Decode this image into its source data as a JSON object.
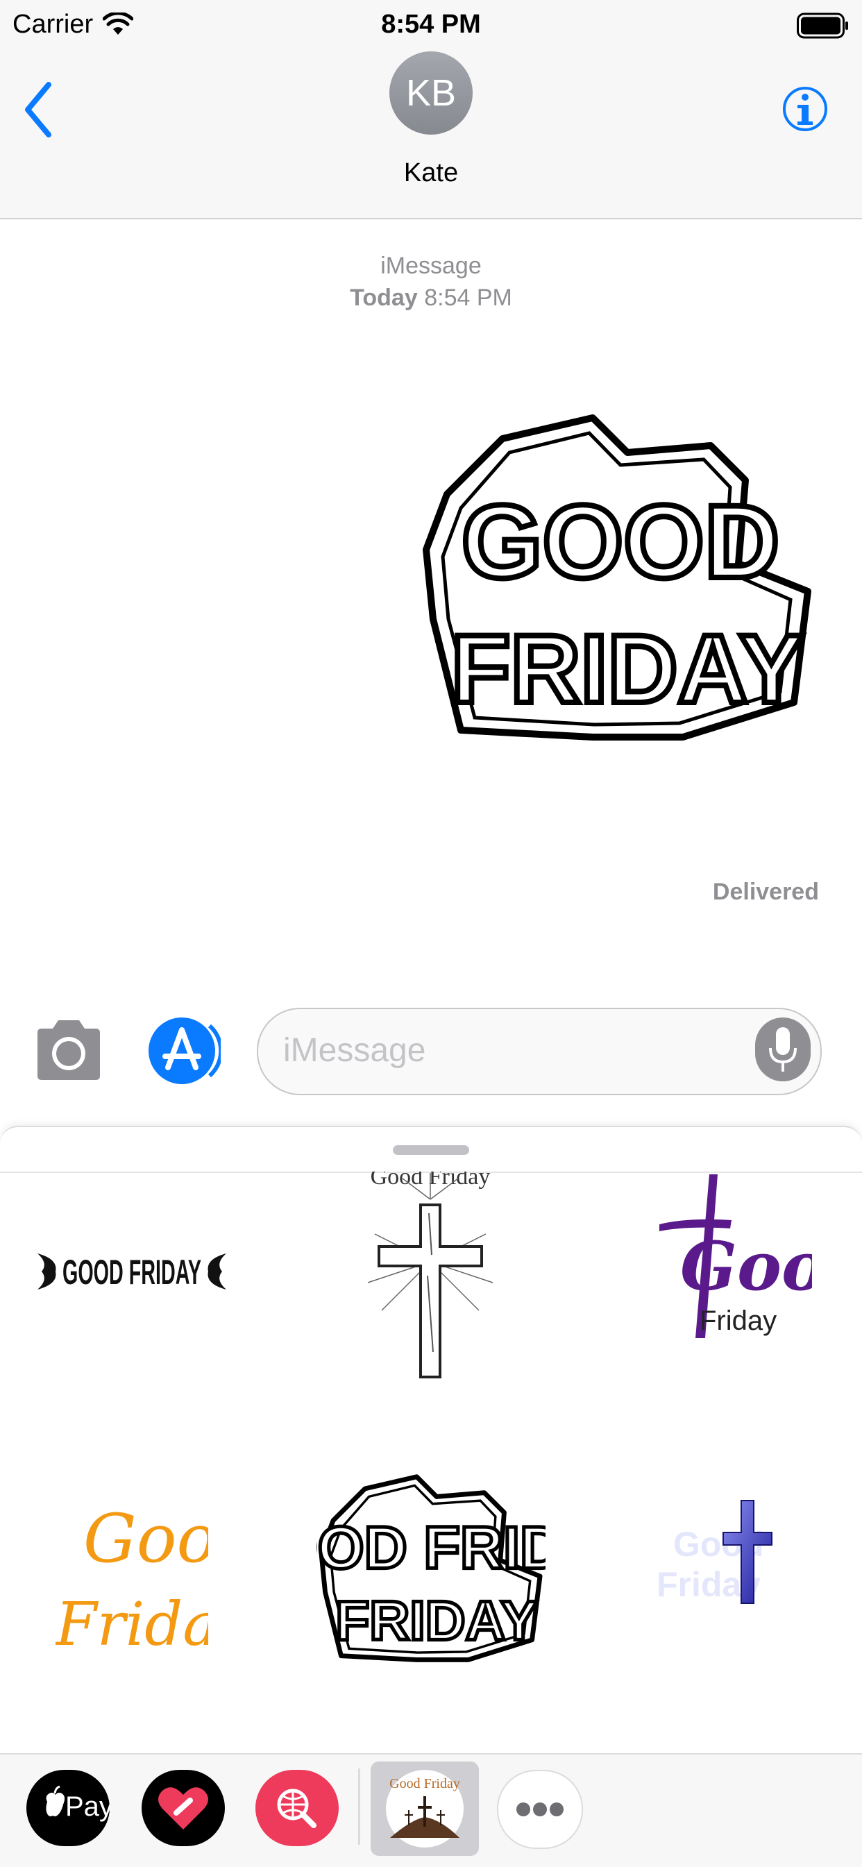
{
  "status_bar": {
    "carrier": "Carrier",
    "time": "8:54 PM"
  },
  "header": {
    "avatar_initials": "KB",
    "contact_name": "Kate"
  },
  "thread": {
    "service": "iMessage",
    "day": "Today",
    "time": "8:54 PM",
    "sticker_text": "GOOD FRIDAY",
    "status": "Delivered"
  },
  "compose": {
    "placeholder": "iMessage"
  },
  "sticker_drawer": {
    "stickers": [
      {
        "text": "GOOD FRIDAY"
      },
      {
        "text": "Good Friday"
      },
      {
        "text_top": "Good",
        "text_bottom": "Friday"
      },
      {
        "text_top": "Good",
        "text_bottom": "Friday"
      },
      {
        "text": "GOOD FRIDAY"
      },
      {
        "text_top": "Good",
        "text_bottom": "Friday"
      }
    ]
  },
  "dock": {
    "apple_pay_label": "Pay",
    "active_app_label": "Good Friday"
  },
  "colors": {
    "accent": "#0a7aff",
    "gray": "#8e8e93",
    "purple": "#5b1a8c",
    "orange": "#f39a12",
    "heart_red": "#ee3b5c"
  }
}
